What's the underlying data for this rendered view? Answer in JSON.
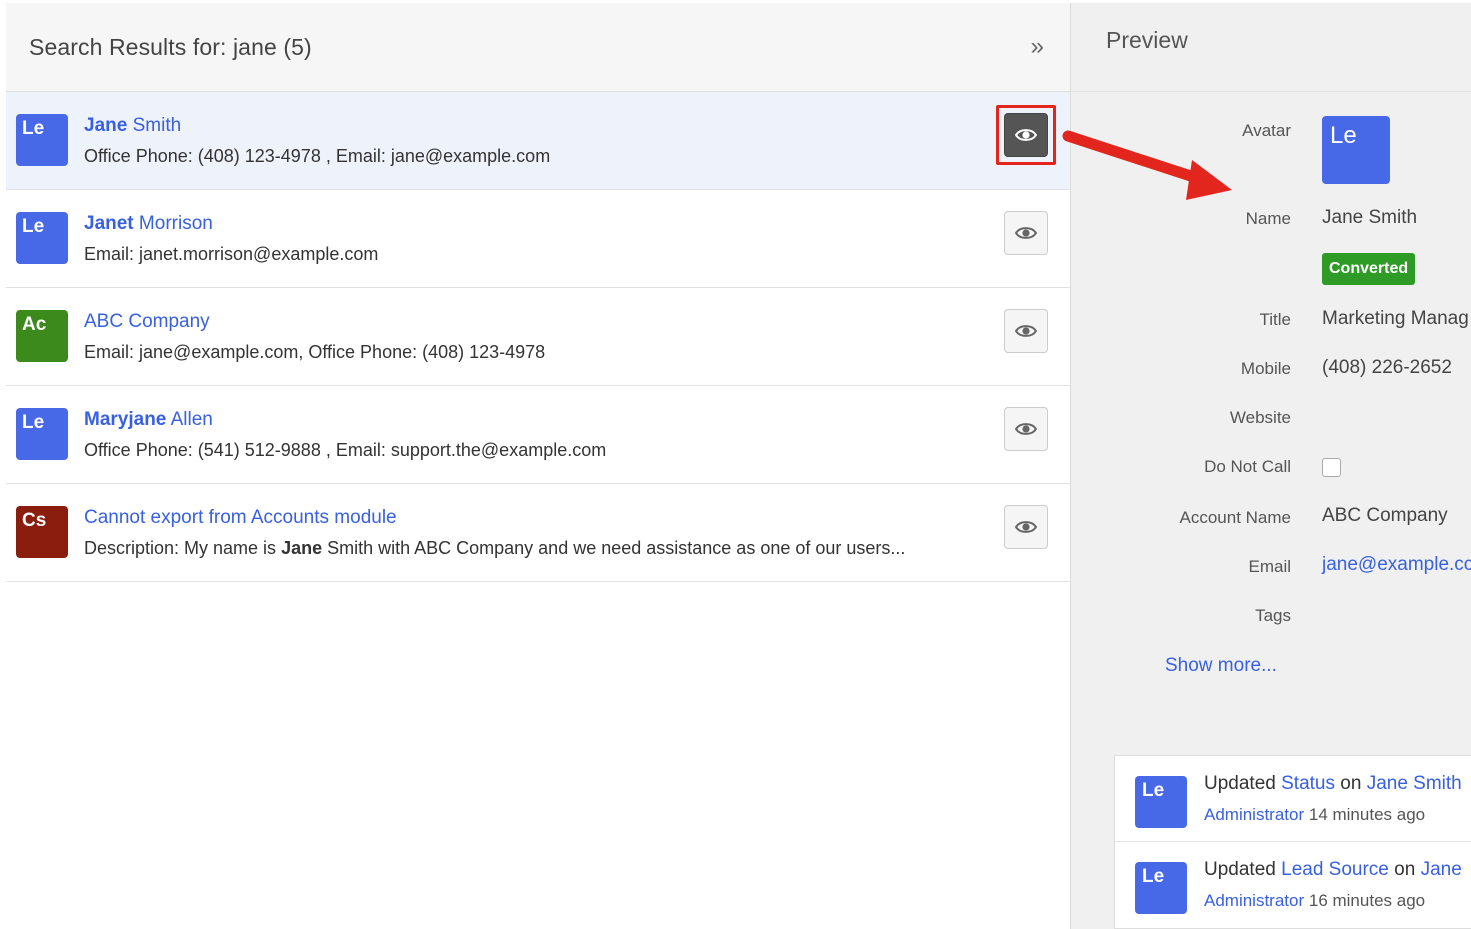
{
  "results": {
    "title": "Search Results for: jane (5)",
    "collapse_icon": "»",
    "items": [
      {
        "badge": "Le",
        "badge_color": "#4769e8",
        "name_hl": "Jane",
        "name_rest": " Smith",
        "desc_pre": "Office Phone: (408) 123-4978 , Email: jane@example.com",
        "desc_hl": "",
        "desc_post": "",
        "active": true
      },
      {
        "badge": "Le",
        "badge_color": "#4769e8",
        "name_hl": "Janet",
        "name_rest": " Morrison",
        "desc_pre": "Email: janet.morrison@example.com",
        "desc_hl": "",
        "desc_post": "",
        "active": false
      },
      {
        "badge": "Ac",
        "badge_color": "#3d8a1c",
        "name_hl": "",
        "name_rest": "ABC Company",
        "desc_pre": "Email: jane@example.com, Office Phone: (408) 123-4978",
        "desc_hl": "",
        "desc_post": "",
        "active": false
      },
      {
        "badge": "Le",
        "badge_color": "#4769e8",
        "name_hl": "Maryjane",
        "name_rest": " Allen",
        "desc_pre": "Office Phone: (541) 512-9888 , Email: support.the@example.com",
        "desc_hl": "",
        "desc_post": "",
        "active": false
      },
      {
        "badge": "Cs",
        "badge_color": "#8a1d0e",
        "name_hl": "",
        "name_rest": "Cannot export from Accounts module",
        "desc_pre": "Description: My name is ",
        "desc_hl": "Jane",
        "desc_post": " Smith with ABC Company and we need assistance as one of our users...",
        "active": false
      }
    ]
  },
  "preview": {
    "title": "Preview",
    "labels": {
      "avatar": "Avatar",
      "name": "Name",
      "title": "Title",
      "mobile": "Mobile",
      "website": "Website",
      "do_not_call": "Do Not Call",
      "account_name": "Account Name",
      "email": "Email",
      "tags": "Tags"
    },
    "values": {
      "avatar": "Le",
      "name": "Jane Smith",
      "status": "Converted",
      "title": "Marketing Manag",
      "mobile": "(408) 226-2652",
      "account_name": "ABC Company",
      "email": "jane@example.cc"
    },
    "show_more": "Show more...",
    "activity": [
      {
        "avatar": "Le",
        "prefix": "Updated ",
        "field": "Status",
        "mid": " on ",
        "target": "Jane Smith",
        "user": "Administrator",
        "time": " 14 minutes ago"
      },
      {
        "avatar": "Le",
        "prefix": "Updated ",
        "field": "Lead Source",
        "mid": " on ",
        "target": "Jane",
        "user": "Administrator",
        "time": " 16 minutes ago"
      }
    ]
  },
  "colors": {
    "link": "#3860e0",
    "lead": "#4769e8",
    "account": "#3d8a1c",
    "case": "#8a1d0e",
    "converted": "#2f9b27",
    "highlight": "#e2261e"
  }
}
